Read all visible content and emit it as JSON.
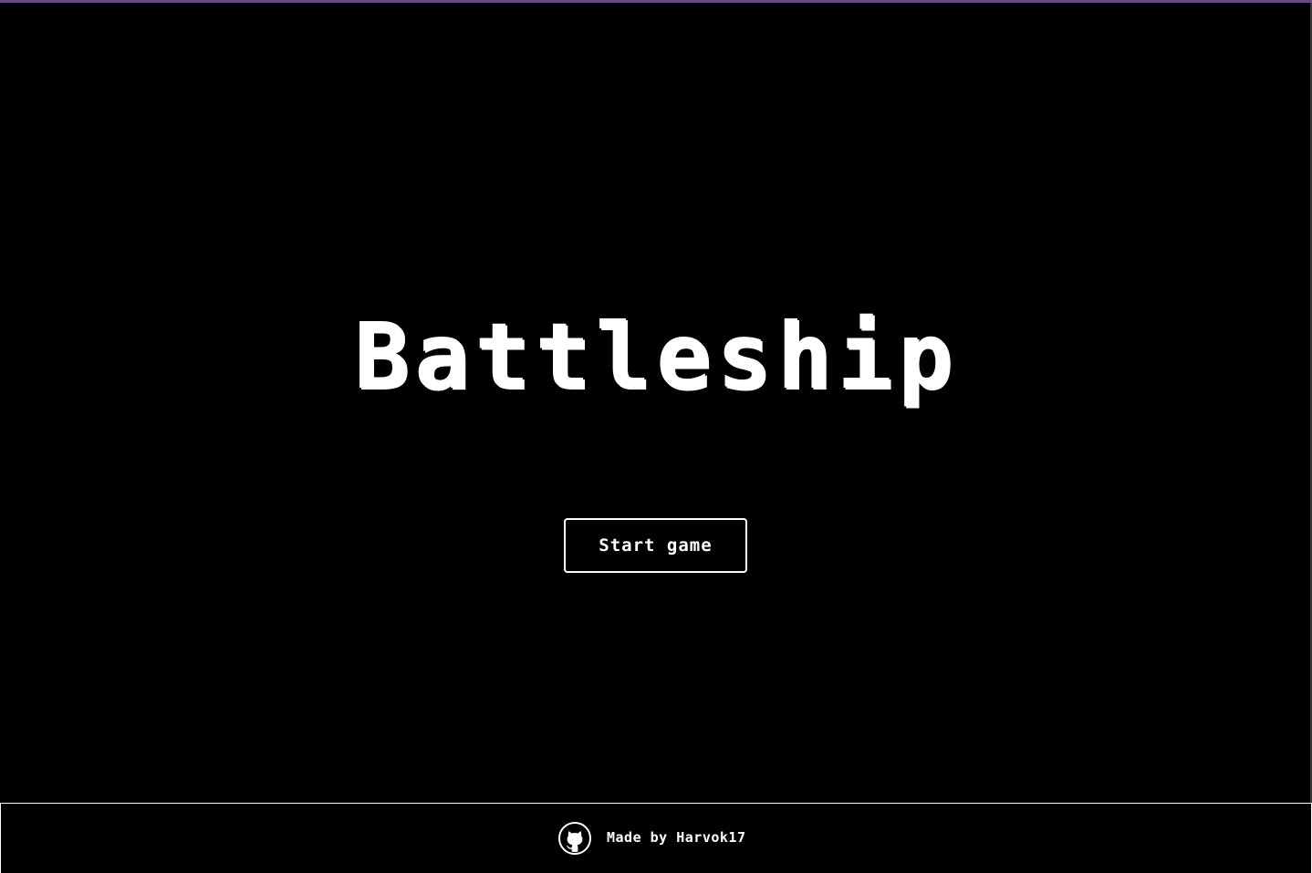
{
  "app": {
    "title": "Battleship"
  },
  "main": {
    "start_button_label": "Start game"
  },
  "footer": {
    "credit_text": "Made by Harvok17",
    "icon": "github-icon"
  },
  "colors": {
    "background": "#000000",
    "foreground": "#ffffff",
    "top_accent": "#6b4a86"
  }
}
